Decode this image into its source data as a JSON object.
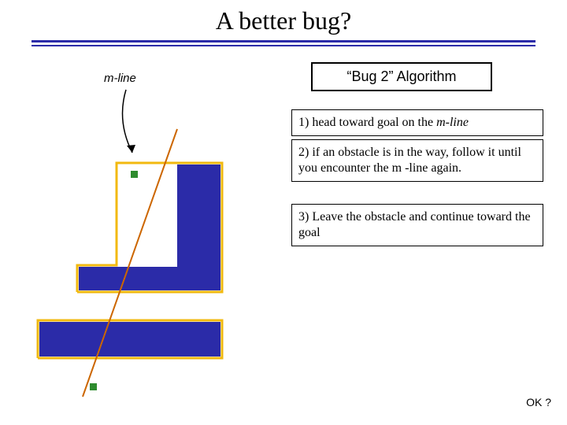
{
  "title": "A better bug?",
  "mline_label": "m-line",
  "algo_title": "“Bug 2” Algorithm",
  "steps": {
    "s1_a": "1) head toward goal on the ",
    "s1_b": "m-line",
    "s2": "2) if an obstacle is in the way, follow it until you encounter the m -line again.",
    "s3": "3) Leave the obstacle and continue toward the goal"
  },
  "footer": "OK ?",
  "diagram": {
    "description": "L-shaped obstacle with yellow path, diagonal m-line, two green waypoints",
    "colors": {
      "obstacle": "#2b2ba8",
      "path": "#f2b90f",
      "mline": "#cc6600",
      "waypoint": "#2e8b2e",
      "arrow": "#000000"
    }
  }
}
